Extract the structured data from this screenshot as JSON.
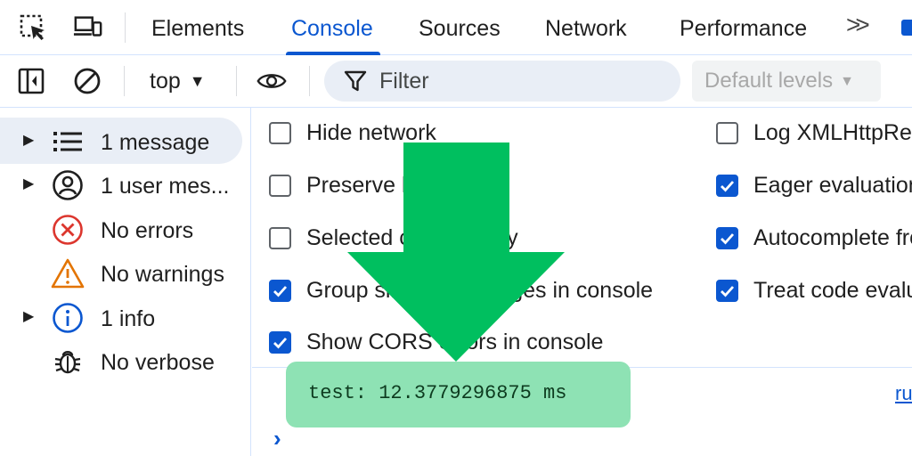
{
  "tabbar": {
    "tabs": [
      {
        "label": "Elements",
        "active": false
      },
      {
        "label": "Console",
        "active": true
      },
      {
        "label": "Sources",
        "active": false
      },
      {
        "label": "Network",
        "active": false
      },
      {
        "label": "Performance",
        "active": false
      }
    ],
    "more_label": ">>",
    "icons": [
      "inspect-element-icon",
      "device-toolbar-icon",
      "more-tabs-icon"
    ]
  },
  "toolbar": {
    "context_label": "top",
    "filter_placeholder": "Filter",
    "levels_label": "Default levels",
    "icons": [
      "sidebar-toggle-icon",
      "clear-console-icon",
      "live-expression-eye-icon",
      "filter-icon"
    ]
  },
  "sidebar": {
    "items": [
      {
        "label": "1 message",
        "icon": "list-icon",
        "expandable": true,
        "selected": true
      },
      {
        "label": "1 user mes...",
        "icon": "user-icon",
        "expandable": true,
        "selected": false
      },
      {
        "label": "No errors",
        "icon": "error-circle-icon",
        "expandable": false,
        "selected": false
      },
      {
        "label": "No warnings",
        "icon": "warning-triangle-icon",
        "expandable": false,
        "selected": false
      },
      {
        "label": "1 info",
        "icon": "info-icon",
        "expandable": true,
        "selected": false
      },
      {
        "label": "No verbose",
        "icon": "bug-icon",
        "expandable": false,
        "selected": false
      }
    ]
  },
  "settings": {
    "left": [
      {
        "label": "Hide network",
        "checked": false
      },
      {
        "label": "Preserve log",
        "checked": false
      },
      {
        "label": "Selected context only",
        "checked": false
      },
      {
        "label": "Group similar messages in console",
        "checked": true
      },
      {
        "label": "Show CORS errors in console",
        "checked": true
      }
    ],
    "right": [
      {
        "label": "Log XMLHttpRequests",
        "checked": false
      },
      {
        "label": "Eager evaluation",
        "checked": true
      },
      {
        "label": "Autocomplete from history",
        "checked": true
      },
      {
        "label": "Treat code evaluation as user action",
        "checked": true
      }
    ]
  },
  "console": {
    "log_text": "test: 12.3779296875 ms",
    "source_link": "ru",
    "prompt_symbol": "›"
  },
  "colors": {
    "accent": "#0b57d0",
    "highlight": "#8ee2b4",
    "arrow": "#00bf5f",
    "error": "#dc362e",
    "warning": "#e37400"
  }
}
